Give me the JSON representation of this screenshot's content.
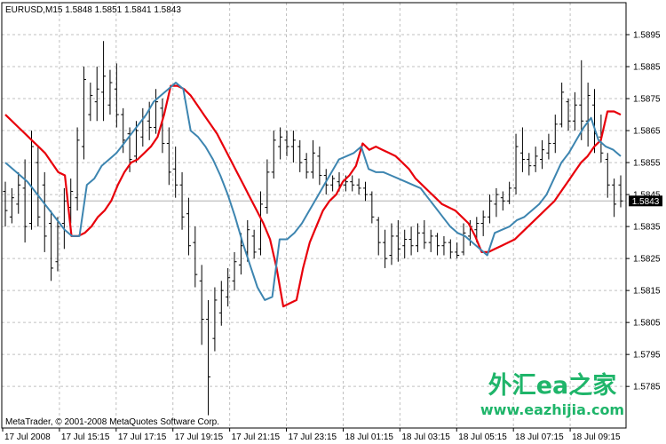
{
  "chart_data": {
    "type": "line",
    "title": "EURUSD,M15  1.5848 1.5851 1.5841 1.5843",
    "ylim": [
      1.5772,
      1.5905
    ],
    "y_ticks": [
      "1.5895",
      "1.5885",
      "1.5875",
      "1.5865",
      "1.5855",
      "1.5845",
      "1.5835",
      "1.5825",
      "1.5815",
      "1.5805",
      "1.5795",
      "1.5785"
    ],
    "x_ticks": [
      "17 Jul 2008",
      "17 Jul 15:15",
      "17 Jul 17:15",
      "17 Jul 19:15",
      "17 Jul 21:15",
      "17 Jul 23:15",
      "18 Jul 01:15",
      "18 Jul 03:15",
      "18 Jul 05:15",
      "18 Jul 07:15",
      "18 Jul 09:15"
    ],
    "current_price": "1.5843",
    "copyright": "MetaTrader, © 2001-2008 MetaQuotes Software Corp.",
    "watermark": {
      "cn": "外汇ea之家",
      "url": "www.eazhijia.com"
    },
    "colors": {
      "bars": "#000000",
      "grid": "#c0c0c0",
      "red_series": "#e8000b",
      "blue_series": "#3d85b0",
      "price_line": "#b0b0b0"
    },
    "bars": [
      {
        "h": 1.5849,
        "l": 1.5835,
        "o": 1.5846,
        "c": 1.584
      },
      {
        "h": 1.5847,
        "l": 1.5836,
        "o": 1.5838,
        "c": 1.5844
      },
      {
        "h": 1.5852,
        "l": 1.5839,
        "o": 1.5842,
        "c": 1.5848
      },
      {
        "h": 1.5856,
        "l": 1.583,
        "o": 1.5847,
        "c": 1.5835
      },
      {
        "h": 1.5865,
        "l": 1.5834,
        "o": 1.5836,
        "c": 1.586
      },
      {
        "h": 1.586,
        "l": 1.5835,
        "o": 1.5855,
        "c": 1.5838
      },
      {
        "h": 1.5852,
        "l": 1.5827,
        "o": 1.5848,
        "c": 1.5832
      },
      {
        "h": 1.584,
        "l": 1.5818,
        "o": 1.5836,
        "c": 1.5822
      },
      {
        "h": 1.5838,
        "l": 1.5821,
        "o": 1.5824,
        "c": 1.5835
      },
      {
        "h": 1.5847,
        "l": 1.5828,
        "o": 1.5836,
        "c": 1.5843
      },
      {
        "h": 1.585,
        "l": 1.5836,
        "o": 1.5841,
        "c": 1.5846
      },
      {
        "h": 1.5866,
        "l": 1.584,
        "o": 1.5844,
        "c": 1.5862
      },
      {
        "h": 1.5885,
        "l": 1.5856,
        "o": 1.586,
        "c": 1.5881
      },
      {
        "h": 1.588,
        "l": 1.5868,
        "o": 1.587,
        "c": 1.5876
      },
      {
        "h": 1.5885,
        "l": 1.5868,
        "o": 1.5874,
        "c": 1.5878
      },
      {
        "h": 1.5893,
        "l": 1.5868,
        "o": 1.5877,
        "c": 1.5882
      },
      {
        "h": 1.5884,
        "l": 1.587,
        "o": 1.5873,
        "c": 1.588
      },
      {
        "h": 1.5886,
        "l": 1.5866,
        "o": 1.5878,
        "c": 1.587
      },
      {
        "h": 1.5872,
        "l": 1.5858,
        "o": 1.587,
        "c": 1.5862
      },
      {
        "h": 1.5866,
        "l": 1.5852,
        "o": 1.5864,
        "c": 1.5856
      },
      {
        "h": 1.5868,
        "l": 1.5855,
        "o": 1.5857,
        "c": 1.5865
      },
      {
        "h": 1.5872,
        "l": 1.586,
        "o": 1.5863,
        "c": 1.5869
      },
      {
        "h": 1.5874,
        "l": 1.5862,
        "o": 1.5868,
        "c": 1.5866
      },
      {
        "h": 1.5878,
        "l": 1.5864,
        "o": 1.5866,
        "c": 1.5874
      },
      {
        "h": 1.5875,
        "l": 1.5858,
        "o": 1.5872,
        "c": 1.5861
      },
      {
        "h": 1.5866,
        "l": 1.5848,
        "o": 1.5861,
        "c": 1.5852
      },
      {
        "h": 1.586,
        "l": 1.5844,
        "o": 1.5853,
        "c": 1.5848
      },
      {
        "h": 1.5852,
        "l": 1.5834,
        "o": 1.5848,
        "c": 1.5838
      },
      {
        "h": 1.5844,
        "l": 1.5826,
        "o": 1.5839,
        "c": 1.5829
      },
      {
        "h": 1.5835,
        "l": 1.5816,
        "o": 1.583,
        "c": 1.582
      },
      {
        "h": 1.5823,
        "l": 1.5798,
        "o": 1.5818,
        "c": 1.5806
      },
      {
        "h": 1.5812,
        "l": 1.5776,
        "o": 1.5806,
        "c": 1.5788
      },
      {
        "h": 1.5816,
        "l": 1.5796,
        "o": 1.58,
        "c": 1.5812
      },
      {
        "h": 1.5818,
        "l": 1.5804,
        "o": 1.5808,
        "c": 1.5815
      },
      {
        "h": 1.5822,
        "l": 1.581,
        "o": 1.5813,
        "c": 1.5819
      },
      {
        "h": 1.5827,
        "l": 1.5815,
        "o": 1.5818,
        "c": 1.5824
      },
      {
        "h": 1.5833,
        "l": 1.582,
        "o": 1.5823,
        "c": 1.5829
      },
      {
        "h": 1.5837,
        "l": 1.5824,
        "o": 1.5827,
        "c": 1.5834
      },
      {
        "h": 1.5834,
        "l": 1.5825,
        "o": 1.5832,
        "c": 1.5827
      },
      {
        "h": 1.5846,
        "l": 1.5826,
        "o": 1.5828,
        "c": 1.5842
      },
      {
        "h": 1.5856,
        "l": 1.5839,
        "o": 1.5841,
        "c": 1.5852
      },
      {
        "h": 1.5865,
        "l": 1.585,
        "o": 1.5852,
        "c": 1.5862
      },
      {
        "h": 1.5866,
        "l": 1.5856,
        "o": 1.586,
        "c": 1.5863
      },
      {
        "h": 1.5865,
        "l": 1.5857,
        "o": 1.5862,
        "c": 1.586
      },
      {
        "h": 1.5865,
        "l": 1.5855,
        "o": 1.586,
        "c": 1.5862
      },
      {
        "h": 1.5862,
        "l": 1.5852,
        "o": 1.586,
        "c": 1.5855
      },
      {
        "h": 1.5858,
        "l": 1.585,
        "o": 1.5856,
        "c": 1.5852
      },
      {
        "h": 1.5862,
        "l": 1.585,
        "o": 1.5852,
        "c": 1.5858
      },
      {
        "h": 1.586,
        "l": 1.5848,
        "o": 1.5857,
        "c": 1.5851
      },
      {
        "h": 1.5853,
        "l": 1.5845,
        "o": 1.5851,
        "c": 1.5848
      },
      {
        "h": 1.5851,
        "l": 1.5846,
        "o": 1.5848,
        "c": 1.585
      },
      {
        "h": 1.5852,
        "l": 1.5846,
        "o": 1.5849,
        "c": 1.5848
      },
      {
        "h": 1.5851,
        "l": 1.5846,
        "o": 1.5848,
        "c": 1.5849
      },
      {
        "h": 1.5851,
        "l": 1.5846,
        "o": 1.5849,
        "c": 1.5848
      },
      {
        "h": 1.585,
        "l": 1.5845,
        "o": 1.5848,
        "c": 1.5847
      },
      {
        "h": 1.5849,
        "l": 1.5843,
        "o": 1.5847,
        "c": 1.5845
      },
      {
        "h": 1.5846,
        "l": 1.5836,
        "o": 1.5845,
        "c": 1.5838
      },
      {
        "h": 1.5838,
        "l": 1.5826,
        "o": 1.5837,
        "c": 1.583
      },
      {
        "h": 1.5834,
        "l": 1.5822,
        "o": 1.583,
        "c": 1.5825
      },
      {
        "h": 1.5836,
        "l": 1.5823,
        "o": 1.5826,
        "c": 1.5832
      },
      {
        "h": 1.5837,
        "l": 1.5824,
        "o": 1.5832,
        "c": 1.5828
      },
      {
        "h": 1.5834,
        "l": 1.5825,
        "o": 1.5829,
        "c": 1.5831
      },
      {
        "h": 1.5835,
        "l": 1.5826,
        "o": 1.5831,
        "c": 1.5829
      },
      {
        "h": 1.5836,
        "l": 1.5827,
        "o": 1.5829,
        "c": 1.5833
      },
      {
        "h": 1.5837,
        "l": 1.5828,
        "o": 1.5833,
        "c": 1.583
      },
      {
        "h": 1.5834,
        "l": 1.5827,
        "o": 1.583,
        "c": 1.5832
      },
      {
        "h": 1.5833,
        "l": 1.5826,
        "o": 1.5832,
        "c": 1.5829
      },
      {
        "h": 1.5832,
        "l": 1.5826,
        "o": 1.5829,
        "c": 1.583
      },
      {
        "h": 1.5831,
        "l": 1.5825,
        "o": 1.583,
        "c": 1.5827
      },
      {
        "h": 1.583,
        "l": 1.5825,
        "o": 1.5827,
        "c": 1.5826
      },
      {
        "h": 1.5836,
        "l": 1.5826,
        "o": 1.5827,
        "c": 1.5833
      },
      {
        "h": 1.5837,
        "l": 1.5829,
        "o": 1.5832,
        "c": 1.5835
      },
      {
        "h": 1.5838,
        "l": 1.583,
        "o": 1.5834,
        "c": 1.5836
      },
      {
        "h": 1.584,
        "l": 1.5832,
        "o": 1.5836,
        "c": 1.5838
      },
      {
        "h": 1.5845,
        "l": 1.5836,
        "o": 1.5838,
        "c": 1.5843
      },
      {
        "h": 1.5847,
        "l": 1.5838,
        "o": 1.5842,
        "c": 1.5845
      },
      {
        "h": 1.5846,
        "l": 1.584,
        "o": 1.5844,
        "c": 1.5843
      },
      {
        "h": 1.5849,
        "l": 1.5842,
        "o": 1.5843,
        "c": 1.5847
      },
      {
        "h": 1.5864,
        "l": 1.5845,
        "o": 1.5847,
        "c": 1.586
      },
      {
        "h": 1.5866,
        "l": 1.5852,
        "o": 1.5858,
        "c": 1.5856
      },
      {
        "h": 1.5858,
        "l": 1.5851,
        "o": 1.5856,
        "c": 1.5854
      },
      {
        "h": 1.586,
        "l": 1.5852,
        "o": 1.5854,
        "c": 1.5857
      },
      {
        "h": 1.5862,
        "l": 1.5853,
        "o": 1.5856,
        "c": 1.5859
      },
      {
        "h": 1.5864,
        "l": 1.5856,
        "o": 1.5858,
        "c": 1.5861
      },
      {
        "h": 1.587,
        "l": 1.5858,
        "o": 1.5861,
        "c": 1.5867
      },
      {
        "h": 1.588,
        "l": 1.5866,
        "o": 1.5867,
        "c": 1.5877
      },
      {
        "h": 1.5875,
        "l": 1.5865,
        "o": 1.5874,
        "c": 1.5868
      },
      {
        "h": 1.5877,
        "l": 1.5865,
        "o": 1.5868,
        "c": 1.5873
      },
      {
        "h": 1.5887,
        "l": 1.5862,
        "o": 1.5873,
        "c": 1.5868
      },
      {
        "h": 1.588,
        "l": 1.586,
        "o": 1.5868,
        "c": 1.5876
      },
      {
        "h": 1.5878,
        "l": 1.5858,
        "o": 1.5873,
        "c": 1.5864
      },
      {
        "h": 1.587,
        "l": 1.5855,
        "o": 1.5863,
        "c": 1.5858
      },
      {
        "h": 1.5858,
        "l": 1.5844,
        "o": 1.5856,
        "c": 1.5848
      },
      {
        "h": 1.585,
        "l": 1.5838,
        "o": 1.5848,
        "c": 1.5842
      },
      {
        "h": 1.5851,
        "l": 1.5841,
        "o": 1.5848,
        "c": 1.5843
      }
    ],
    "series": [
      {
        "values": [
          1.587,
          1.5868,
          1.5866,
          1.5864,
          1.5862,
          1.586,
          1.5858,
          1.5855,
          1.5852,
          1.5851,
          1.5832,
          1.5832,
          1.5833,
          1.5835,
          1.5838,
          1.584,
          1.5843,
          1.5848,
          1.5852,
          1.5855,
          1.5856,
          1.5858,
          1.586,
          1.5863,
          1.587,
          1.5879,
          1.5879,
          1.5878,
          1.5876,
          1.5873,
          1.587,
          1.5867,
          1.5864,
          1.586,
          1.5856,
          1.5852,
          1.5848,
          1.5844,
          1.584,
          1.5836,
          1.5831,
          1.5822,
          1.581,
          1.5811,
          1.5812,
          1.5822,
          1.583,
          1.5835,
          1.584,
          1.5843,
          1.5845,
          1.5849,
          1.5851,
          1.5854,
          1.5861,
          1.5859,
          1.586,
          1.5859,
          1.5858,
          1.5857,
          1.5855,
          1.5853,
          1.585,
          1.5848,
          1.5846,
          1.5844,
          1.5842,
          1.5841,
          1.584,
          1.5838,
          1.5836,
          1.5832,
          1.5827,
          1.5827,
          1.5828,
          1.5829,
          1.583,
          1.5831,
          1.5833,
          1.5835,
          1.5837,
          1.5839,
          1.5841,
          1.5843,
          1.5846,
          1.5849,
          1.5852,
          1.5855,
          1.5857,
          1.586,
          1.5862,
          1.5871,
          1.5871,
          1.587
        ]
      },
      {
        "values": [
          1.5855,
          1.5853,
          1.5851,
          1.5849,
          1.5846,
          1.5843,
          1.584,
          1.5837,
          1.5834,
          1.5832,
          1.5832,
          1.5848,
          1.585,
          1.5854,
          1.5856,
          1.5858,
          1.5861,
          1.5864,
          1.5867,
          1.587,
          1.5874,
          1.5876,
          1.5878,
          1.588,
          1.5878,
          1.5865,
          1.5863,
          1.586,
          1.5856,
          1.5851,
          1.5845,
          1.5838,
          1.583,
          1.5823,
          1.5816,
          1.5812,
          1.5813,
          1.5831,
          1.5831,
          1.5833,
          1.5836,
          1.584,
          1.5844,
          1.5848,
          1.5852,
          1.5856,
          1.5857,
          1.5858,
          1.586,
          1.5853,
          1.5852,
          1.5852,
          1.5851,
          1.585,
          1.5849,
          1.5848,
          1.5847,
          1.5844,
          1.5841,
          1.5838,
          1.5835,
          1.5833,
          1.5832,
          1.583,
          1.5828,
          1.5826,
          1.5833,
          1.5834,
          1.5835,
          1.5837,
          1.5838,
          1.584,
          1.5842,
          1.5845,
          1.585,
          1.5855,
          1.5858,
          1.5862,
          1.5866,
          1.5869,
          1.5862,
          1.586,
          1.5859,
          1.5857
        ]
      }
    ]
  }
}
